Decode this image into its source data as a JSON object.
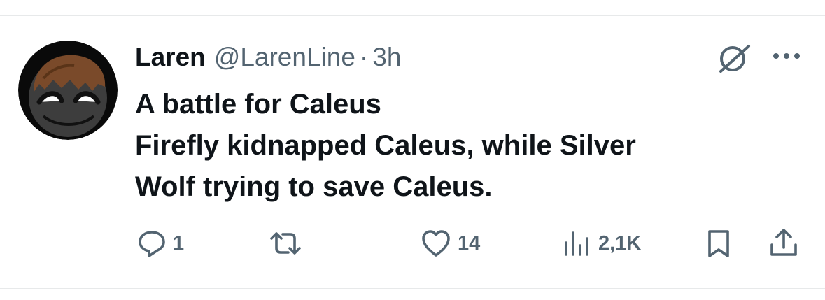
{
  "tweet": {
    "author_name": "Laren",
    "handle": "@LarenLine",
    "separator": "·",
    "time": "3h",
    "lines": [
      "A battle for Caleus",
      "Firefly kidnapped Caleus, while Silver",
      "Wolf trying to save Caleus."
    ]
  },
  "actions": {
    "reply_count": "1",
    "repost_count": "",
    "like_count": "14",
    "views_count": "2,1K"
  },
  "icons": {
    "avatar": "avatar",
    "grok": "grok-icon",
    "more": "more-icon",
    "reply": "reply-icon",
    "repost": "repost-icon",
    "like": "heart-icon",
    "views": "views-icon",
    "bookmark": "bookmark-icon",
    "share": "share-icon"
  },
  "colors": {
    "text_primary": "#0f1419",
    "text_secondary": "#536471",
    "divider": "#e7e9ea",
    "avatar_face": "#3d3d3d",
    "avatar_hair": "#7a4a2a"
  }
}
